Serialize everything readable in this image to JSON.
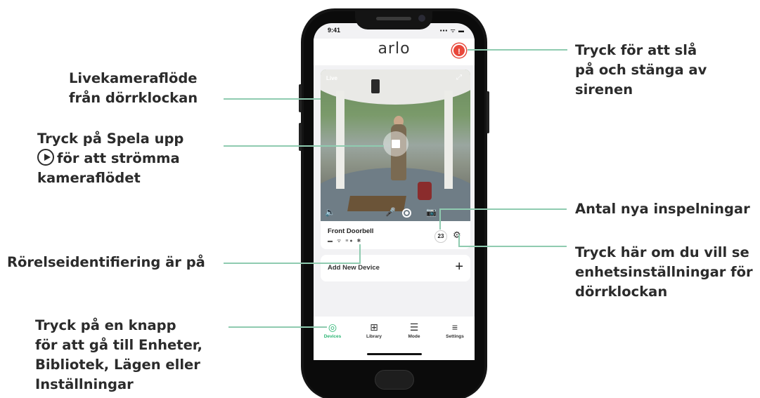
{
  "callouts": {
    "live_feed": [
      "Livekameraflöde",
      "från dörrklockan"
    ],
    "play": [
      "Tryck på Spela upp",
      "för att strömma",
      "kameraflödet"
    ],
    "motion": "Rörelseidentifiering är på",
    "tabs": [
      "Tryck på en knapp",
      "för att gå till Enheter,",
      "Bibliotek, Lägen eller",
      "Inställningar"
    ],
    "siren": [
      "Tryck för att slå",
      "på och stänga av",
      "sirenen"
    ],
    "recordings": "Antal nya inspelningar",
    "settings": [
      "Tryck här om du vill se",
      "enhetsinställningar för",
      "dörrklockan"
    ]
  },
  "phone": {
    "status_time": "9:41",
    "status_icons": "▪▪▪ ᯤ ▬",
    "app_logo": "arlo",
    "siren_icon": "siren-shield-icon",
    "camera": {
      "live_label": "Live",
      "device_name": "Front Doorbell",
      "new_recordings": "23"
    },
    "add_device_label": "Add New Device",
    "tabs": [
      {
        "label": "Devices",
        "icon": "devices-icon",
        "active": true
      },
      {
        "label": "Library",
        "icon": "library-icon",
        "active": false
      },
      {
        "label": "Mode",
        "icon": "mode-icon",
        "active": false
      },
      {
        "label": "Settings",
        "icon": "settings-menu-icon",
        "active": false
      }
    ]
  },
  "colors": {
    "accent_green": "#2bb573",
    "callout_line": "#8fcbb0",
    "siren_red": "#e8483b"
  }
}
